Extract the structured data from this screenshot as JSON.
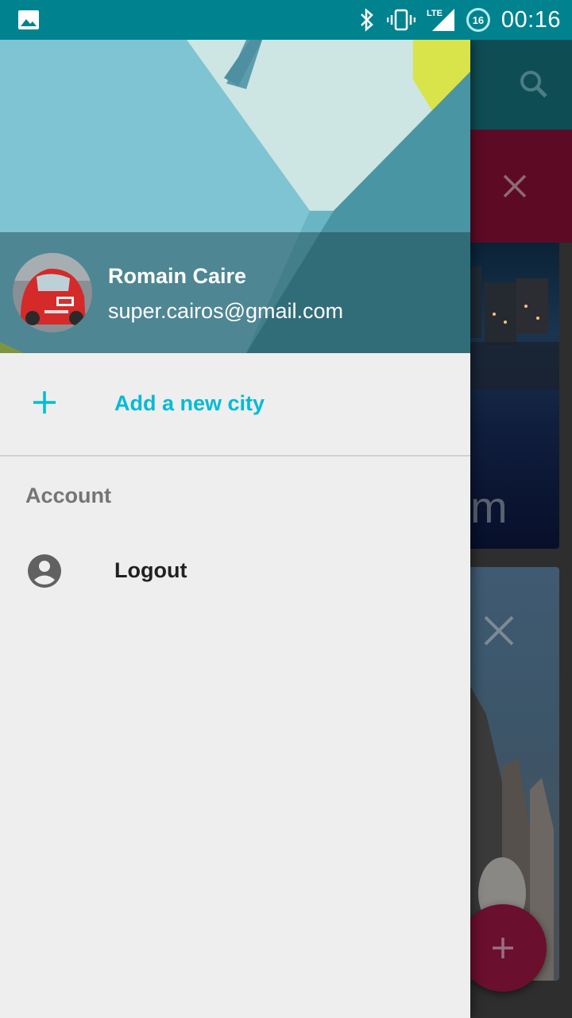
{
  "status_bar": {
    "time": "00:16",
    "network_label": "LTE",
    "notification_badge": "16",
    "icons": [
      "image-icon",
      "bluetooth-icon",
      "vibrate-icon",
      "signal-icon",
      "badge-icon"
    ],
    "color": "#00838f"
  },
  "drawer": {
    "user": {
      "name": "Romain Caire",
      "email": "super.cairos@gmail.com"
    },
    "add_city": {
      "label": "Add a new city",
      "icon": "plus-icon",
      "color": "#00bcd4"
    },
    "section": {
      "title": "Account"
    },
    "logout": {
      "label": "Logout",
      "icon": "account-circle-icon"
    }
  },
  "background_app": {
    "partial_text": "m",
    "icons": [
      "search-icon",
      "close-icon",
      "close-icon",
      "fab-plus-icon"
    ],
    "accent": "#880e4f"
  }
}
